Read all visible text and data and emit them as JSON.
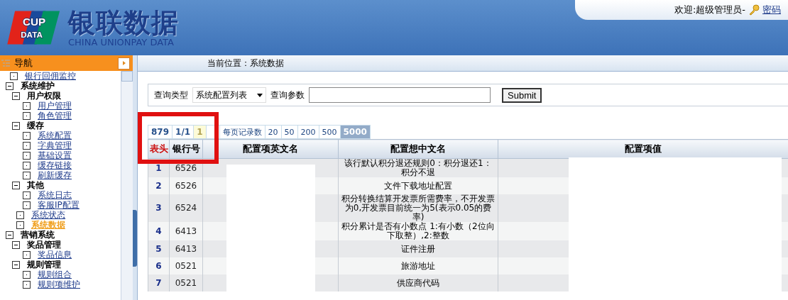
{
  "header": {
    "logo_top": "CUP",
    "logo_bottom": "DATA",
    "name": "银联数据",
    "name_en": "CHINA UNIONPAY DATA",
    "welcome": "欢迎:超级管理员-",
    "password_link": "密码"
  },
  "nav": {
    "title": "导航",
    "tree": [
      {
        "label": "银行回佣监控",
        "kind": "link",
        "selected": false
      },
      {
        "label": "系统维护",
        "kind": "group",
        "expanded": true,
        "children": [
          {
            "label": "用户权限",
            "kind": "group",
            "expanded": true,
            "children": [
              {
                "label": "用户管理",
                "kind": "link",
                "selected": false
              },
              {
                "label": "角色管理",
                "kind": "link",
                "selected": false
              }
            ]
          },
          {
            "label": "缓存",
            "kind": "group",
            "expanded": true,
            "children": [
              {
                "label": "系统配置",
                "kind": "link",
                "selected": false
              },
              {
                "label": "字典管理",
                "kind": "link",
                "selected": false
              },
              {
                "label": "基础设置",
                "kind": "link",
                "selected": false
              },
              {
                "label": "缓存链接",
                "kind": "link",
                "selected": false
              },
              {
                "label": "刷新缓存",
                "kind": "link",
                "selected": false
              }
            ]
          },
          {
            "label": "其他",
            "kind": "group",
            "expanded": true,
            "children": [
              {
                "label": "系统日志",
                "kind": "link",
                "selected": false
              },
              {
                "label": "客服IP配置",
                "kind": "link",
                "selected": false
              }
            ]
          },
          {
            "label": "系统状态",
            "kind": "link",
            "selected": false
          },
          {
            "label": "系统数据",
            "kind": "link",
            "selected": true
          }
        ]
      },
      {
        "label": "营销系统",
        "kind": "group",
        "expanded": true,
        "children": [
          {
            "label": "奖品管理",
            "kind": "group",
            "expanded": true,
            "children": [
              {
                "label": "奖品信息",
                "kind": "link",
                "selected": false
              }
            ]
          },
          {
            "label": "规则管理",
            "kind": "group",
            "expanded": true,
            "children": [
              {
                "label": "规则组合",
                "kind": "link",
                "selected": false
              },
              {
                "label": "规则项维护",
                "kind": "link",
                "selected": false
              }
            ]
          }
        ]
      }
    ]
  },
  "breadcrumb": "当前位置：系统数据",
  "query": {
    "type_label": "查询类型",
    "type_value": "系统配置列表",
    "param_label": "查询参数",
    "submit": "Submit"
  },
  "pager": {
    "total": "879",
    "pages": "1/1",
    "page_buttons": [
      {
        "label": "1",
        "selected": true
      }
    ],
    "page_size_label": "每页记录数",
    "page_sizes": [
      {
        "label": "20",
        "selected": false
      },
      {
        "label": "50",
        "selected": false
      },
      {
        "label": "200",
        "selected": false
      },
      {
        "label": "500",
        "selected": false
      },
      {
        "label": "5000",
        "selected": true
      }
    ]
  },
  "table": {
    "columns": [
      "表头",
      "银行号",
      "配置项英文名",
      "配置想中文名",
      "配置项值"
    ],
    "rows": [
      {
        "index": "1",
        "bank": "6526",
        "name_cn": "该行默认积分退还规则0：积分退还1：积分不退"
      },
      {
        "index": "2",
        "bank": "6526",
        "name_cn": "文件下载地址配置"
      },
      {
        "index": "3",
        "bank": "6524",
        "name_cn": "积分转换结算开发票所需费率，不开发票为0,开发票目前统一为5(表示0.05的费率)"
      },
      {
        "index": "4",
        "bank": "6413",
        "name_cn": "积分累计是否有小数点 1:有小数（2位向下取整）,2:整数"
      },
      {
        "index": "5",
        "bank": "6413",
        "name_cn": "证件注册"
      },
      {
        "index": "6",
        "bank": "0521",
        "name_cn": "旅游地址"
      },
      {
        "index": "7",
        "bank": "0521",
        "name_cn": "供应商代码"
      }
    ]
  }
}
